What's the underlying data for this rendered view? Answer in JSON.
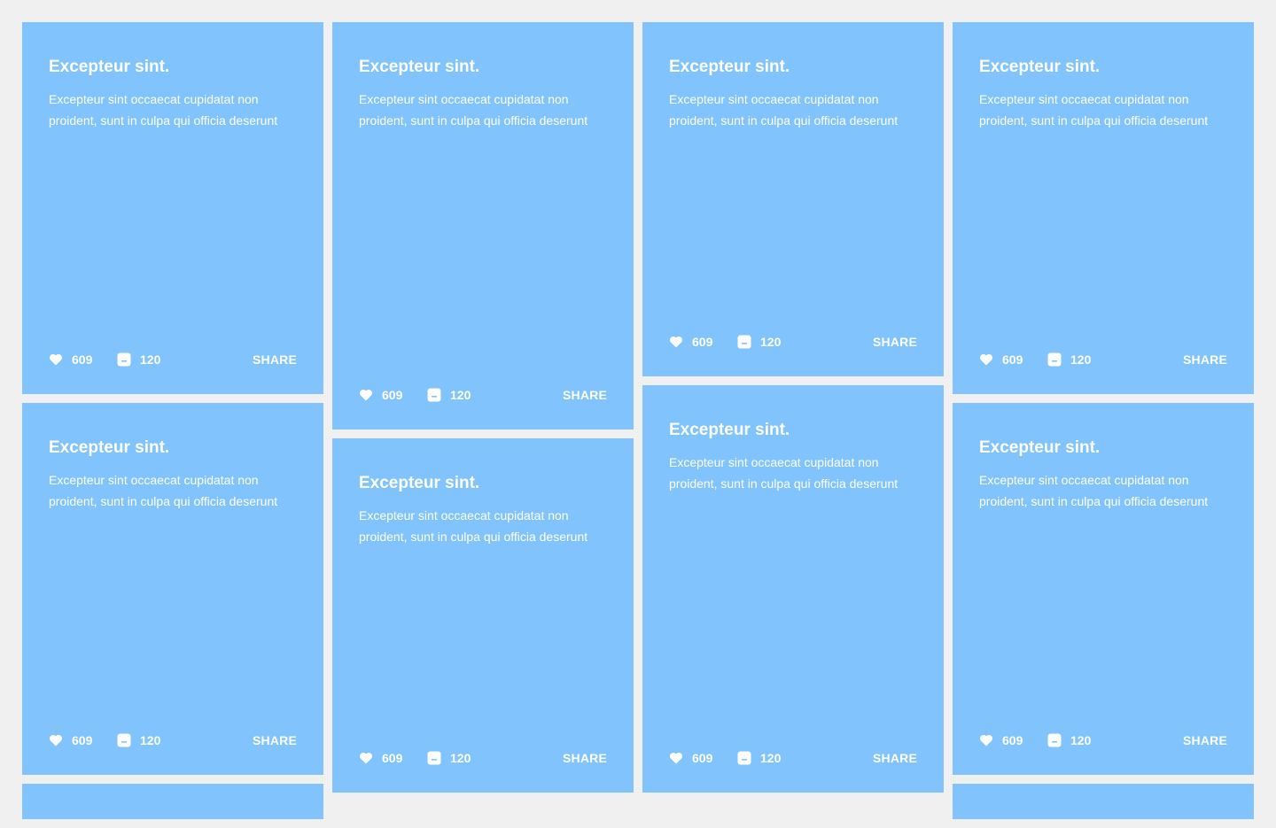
{
  "theme": {
    "background": "#f0f0f0",
    "card_color": "#80c3fd",
    "text_color": "#ffffff"
  },
  "cards": [
    {
      "title": "Excepteur sint.",
      "body": "Excepteur sint occaecat cupidatat non proident, sunt in culpa qui officia deserunt",
      "likes": "609",
      "comments": "120",
      "share_label": "SHARE"
    },
    {
      "title": "Excepteur sint.",
      "body": "Excepteur sint occaecat cupidatat non proident, sunt in culpa qui officia deserunt",
      "likes": "609",
      "comments": "120",
      "share_label": "SHARE"
    },
    {
      "title": "",
      "body": "",
      "likes": "",
      "comments": "",
      "share_label": ""
    },
    {
      "title": "Excepteur sint.",
      "body": "Excepteur sint occaecat cupidatat non proident, sunt in culpa qui officia deserunt",
      "likes": "609",
      "comments": "120",
      "share_label": "SHARE"
    },
    {
      "title": "Excepteur sint.",
      "body": "Excepteur sint occaecat cupidatat non proident, sunt in culpa qui officia deserunt",
      "likes": "609",
      "comments": "120",
      "share_label": "SHARE"
    },
    {
      "title": "Excepteur sint.",
      "body": "Excepteur sint occaecat cupidatat non proident, sunt in culpa qui officia deserunt",
      "likes": "609",
      "comments": "120",
      "share_label": "SHARE"
    },
    {
      "title": "Excepteur sint.",
      "body": "Excepteur sint occaecat cupidatat non proident, sunt in culpa qui officia deserunt",
      "likes": "609",
      "comments": "120",
      "share_label": "SHARE"
    },
    {
      "title": "Excepteur sint.",
      "body": "Excepteur sint occaecat cupidatat non proident, sunt in culpa qui officia deserunt",
      "likes": "609",
      "comments": "120",
      "share_label": "SHARE"
    },
    {
      "title": "Excepteur sint.",
      "body": "Excepteur sint occaecat cupidatat non proident, sunt in culpa qui officia deserunt",
      "likes": "609",
      "comments": "120",
      "share_label": "SHARE"
    },
    {
      "title": "",
      "body": "",
      "likes": "",
      "comments": "",
      "share_label": ""
    },
    {
      "title": "Excepteur sint.",
      "body": "Excepteur sint occaecat cupidatat non proident, sunt in culpa qui officia deserunt",
      "likes": "609",
      "comments": "120",
      "share_label": "SHARE"
    }
  ]
}
